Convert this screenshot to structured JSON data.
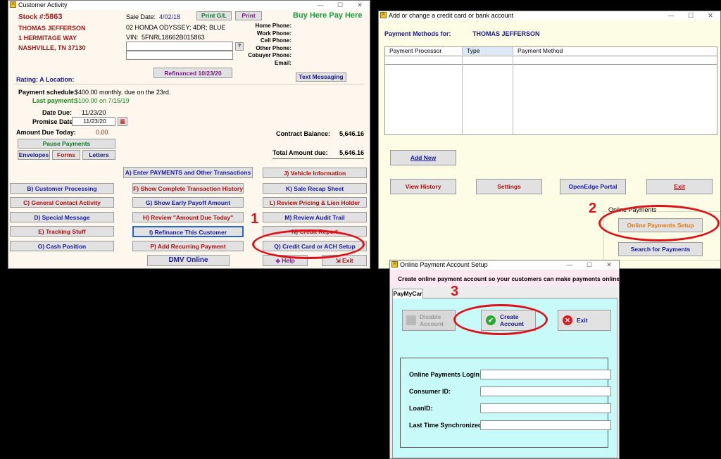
{
  "customer_activity": {
    "title": "Customer Activity",
    "stock_label": "Stock #:",
    "stock_number": "5863",
    "customer_name": "THOMAS JEFFERSON",
    "address1": "1 HERMITAGE WAY",
    "address2": "NASHVILLE, TN 37130",
    "sale_date_label": "Sale Date:",
    "sale_date": "4/02/18",
    "print_gl": "Print G/L",
    "print": "Print",
    "slogan": "Buy Here Pay Here",
    "vehicle": "02 HONDA ODYSSEY; 4DR; BLUE",
    "vin_label": "VIN:",
    "vin": "5FNRL18662B015863",
    "phones": [
      "Home Phone:",
      "Work Phone:",
      "Cell Phone:",
      "Other Phone:",
      "Cobuyer Phone:",
      "Email:"
    ],
    "question": "?",
    "refinanced": "Refinanced 10/23/20",
    "rating": "Rating: A   Location:",
    "text_messaging": "Text Messaging",
    "payment_schedule_label": "Payment schedule:",
    "payment_schedule": "$400.00 monthly. due on the 23rd.",
    "last_payment_label": "Last payment:",
    "last_payment": "$100.00 on  7/15/19",
    "date_due_label": "Date Due:",
    "date_due": "11/23/20",
    "promise_label": "Promise Date:",
    "promise_date": "11/23/20",
    "amount_due_label": "Amount Due Today:",
    "amount_due": "0.00",
    "contract_balance_label": "Contract Balance:",
    "contract_balance": "5,646.16",
    "total_due_label": "Total Amount due:",
    "total_due": "5,646.16",
    "pause_payments": "Pause Payments",
    "envelopes": "Envelopes",
    "forms": "Forms",
    "letters": "Letters",
    "btn_a": "A) Enter PAYMENTS and Other Transactions",
    "btn_j": "J) Vehicle Information",
    "btn_b": "B) Customer Processing",
    "btn_f": "F) Show Complete Transaction History",
    "btn_k": "K) Sale Recap Sheet",
    "btn_c": "C) General Contact Activity",
    "btn_g": "G) Show Early Payoff Amount",
    "btn_l": "L) Review Pricing & Lien Holder",
    "btn_d": "D) Special Message",
    "btn_h": "H) Review \"Amount Due Today\"",
    "btn_m": "M) Review Audit Trail",
    "btn_e": "E) Tracking Stuff",
    "btn_i": "I) Refinance This Customer",
    "btn_n": "N) Credit Report",
    "btn_o": "O) Cash Position",
    "btn_p": "P) Add Recurring Payment",
    "btn_q": "Q) Credit Card or ACH Setup",
    "dmv": "DMV Online",
    "help": "Help",
    "exit": "Exit"
  },
  "payment_methods": {
    "title": "Add or change a credit card or bank account",
    "for_label": "Payment Methods for:",
    "customer_name": "THOMAS JEFFERSON",
    "columns": [
      "Payment Processor",
      "Type",
      "Payment Method"
    ],
    "add_new": "Add New",
    "view_history": "View History",
    "settings": "Settings",
    "openedge": "OpenEdge Portal",
    "exit": "Exit",
    "online_payments_group": "Online Payments",
    "online_setup": "Online Payments Setup",
    "search_payments": "Search for Payments"
  },
  "online_setup": {
    "title": "Online Payment Account Setup",
    "subtitle": "Create online payment account so your customers can make payments online.",
    "tab": "PayMyCar",
    "disable": "Disable Account",
    "create": "Create Account",
    "exit": "Exit",
    "fields": [
      "Online Payments Login:",
      "Consumer ID:",
      "LoanID:",
      "Last Time Synchronized:"
    ]
  },
  "steps": [
    "1",
    "2",
    "3"
  ],
  "colors": {
    "ring": "#e0101a",
    "cyan_panel": "#c8fafa",
    "cream": "#fff9ec",
    "yellow_panel": "#fdfde6"
  }
}
